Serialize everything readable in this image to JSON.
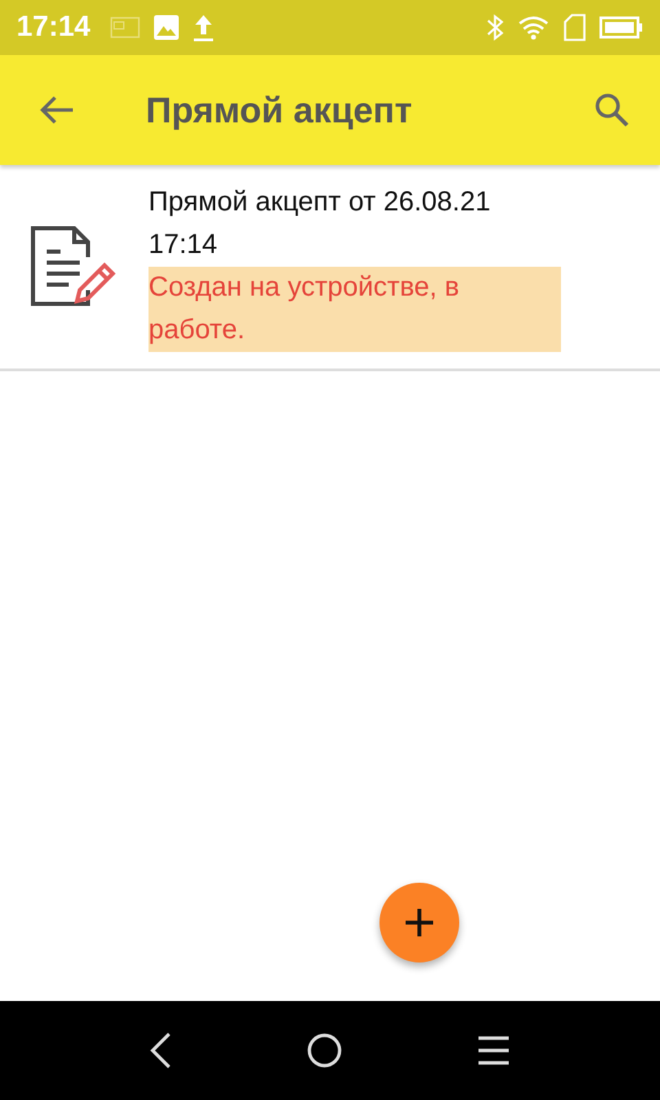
{
  "status_bar": {
    "time": "17:14"
  },
  "app_bar": {
    "title": "Прямой акцепт"
  },
  "documents": [
    {
      "title": "Прямой акцепт от 26.08.21 17:14",
      "status": "Создан на устройстве, в работе."
    }
  ]
}
